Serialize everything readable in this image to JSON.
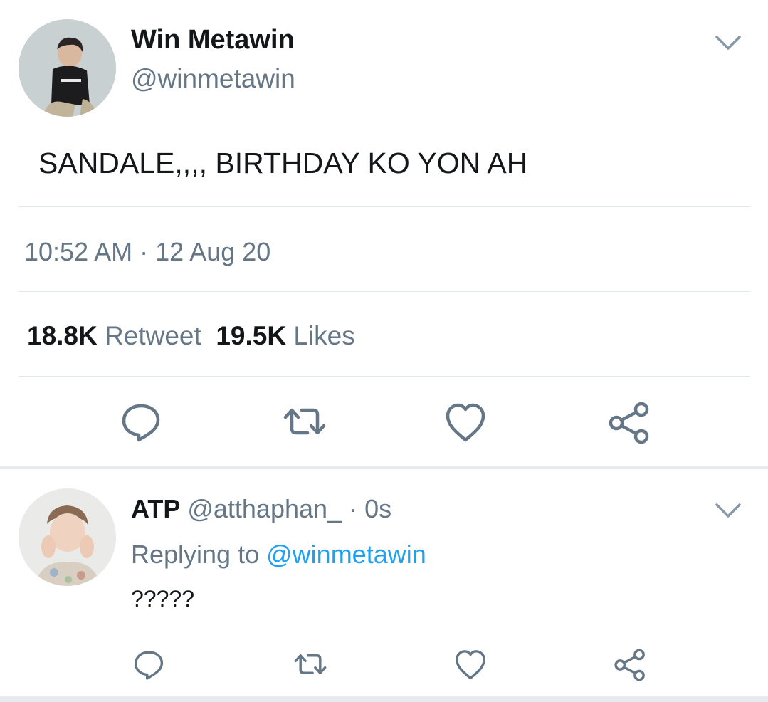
{
  "tweet": {
    "author_name": "Win Metawin",
    "author_handle": "@winmetawin",
    "text": "SANDALE,,,, BIRTHDAY KO YON AH",
    "time": "10:52 AM",
    "date_separator": "·",
    "date": "12 Aug 20",
    "retweet_count": "18.8K",
    "retweet_label": "Retweet",
    "like_count": "19.5K",
    "like_label": "Likes"
  },
  "reply": {
    "author_name": "ATP",
    "author_handle": "@atthaphan_",
    "time": "· 0s",
    "replying_prefix": "Replying to",
    "replying_to": "@winmetawin",
    "text": "?????"
  },
  "icons": {
    "reply": "reply-icon",
    "retweet": "retweet-icon",
    "like": "heart-icon",
    "share": "share-icon",
    "menu": "chevron-down-icon"
  },
  "colors": {
    "text_primary": "#14171a",
    "text_secondary": "#657786",
    "link": "#1da1f2",
    "divider": "#e1e8ed",
    "icon": "#657786"
  }
}
